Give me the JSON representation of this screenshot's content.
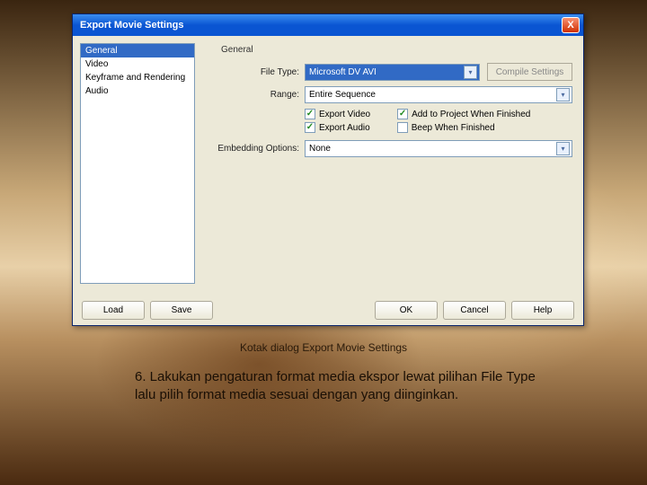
{
  "dialog": {
    "title": "Export Movie Settings",
    "close_label": "X",
    "panel_title": "General",
    "sidebar": {
      "items": [
        {
          "label": "General",
          "selected": true
        },
        {
          "label": "Video",
          "selected": false
        },
        {
          "label": "Keyframe and Rendering",
          "selected": false
        },
        {
          "label": "Audio",
          "selected": false
        }
      ]
    },
    "form": {
      "file_type_label": "File Type:",
      "file_type_value": "Microsoft DV AVI",
      "compile_btn": "Compile Settings",
      "range_label": "Range:",
      "range_value": "Entire Sequence",
      "chk_export_video": "Export Video",
      "chk_export_audio": "Export Audio",
      "chk_add_project": "Add to Project When Finished",
      "chk_beep": "Beep When Finished",
      "embed_label": "Embedding Options:",
      "embed_value": "None"
    },
    "buttons": {
      "load": "Load",
      "save": "Save",
      "ok": "OK",
      "cancel": "Cancel",
      "help": "Help"
    }
  },
  "caption": "Kotak dialog Export Movie Settings",
  "instruction": "6. Lakukan pengaturan format media ekspor lewat pilihan File Type lalu pilih format media sesuai dengan yang diinginkan."
}
